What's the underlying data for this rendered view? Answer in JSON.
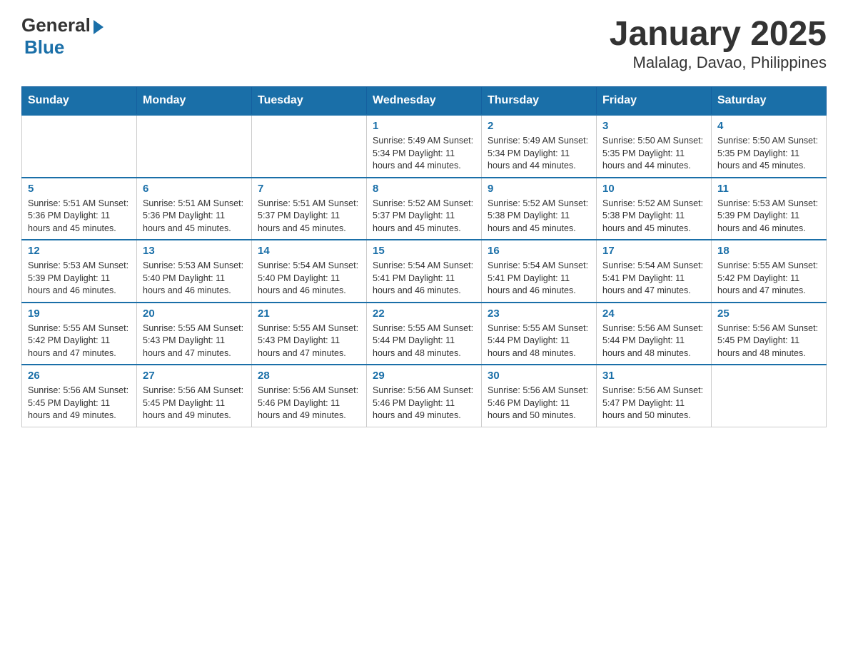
{
  "header": {
    "logo_general": "General",
    "logo_blue": "Blue",
    "title": "January 2025",
    "subtitle": "Malalag, Davao, Philippines"
  },
  "calendar": {
    "days_of_week": [
      "Sunday",
      "Monday",
      "Tuesday",
      "Wednesday",
      "Thursday",
      "Friday",
      "Saturday"
    ],
    "weeks": [
      [
        {
          "day": "",
          "info": ""
        },
        {
          "day": "",
          "info": ""
        },
        {
          "day": "",
          "info": ""
        },
        {
          "day": "1",
          "info": "Sunrise: 5:49 AM\nSunset: 5:34 PM\nDaylight: 11 hours and 44 minutes."
        },
        {
          "day": "2",
          "info": "Sunrise: 5:49 AM\nSunset: 5:34 PM\nDaylight: 11 hours and 44 minutes."
        },
        {
          "day": "3",
          "info": "Sunrise: 5:50 AM\nSunset: 5:35 PM\nDaylight: 11 hours and 44 minutes."
        },
        {
          "day": "4",
          "info": "Sunrise: 5:50 AM\nSunset: 5:35 PM\nDaylight: 11 hours and 45 minutes."
        }
      ],
      [
        {
          "day": "5",
          "info": "Sunrise: 5:51 AM\nSunset: 5:36 PM\nDaylight: 11 hours and 45 minutes."
        },
        {
          "day": "6",
          "info": "Sunrise: 5:51 AM\nSunset: 5:36 PM\nDaylight: 11 hours and 45 minutes."
        },
        {
          "day": "7",
          "info": "Sunrise: 5:51 AM\nSunset: 5:37 PM\nDaylight: 11 hours and 45 minutes."
        },
        {
          "day": "8",
          "info": "Sunrise: 5:52 AM\nSunset: 5:37 PM\nDaylight: 11 hours and 45 minutes."
        },
        {
          "day": "9",
          "info": "Sunrise: 5:52 AM\nSunset: 5:38 PM\nDaylight: 11 hours and 45 minutes."
        },
        {
          "day": "10",
          "info": "Sunrise: 5:52 AM\nSunset: 5:38 PM\nDaylight: 11 hours and 45 minutes."
        },
        {
          "day": "11",
          "info": "Sunrise: 5:53 AM\nSunset: 5:39 PM\nDaylight: 11 hours and 46 minutes."
        }
      ],
      [
        {
          "day": "12",
          "info": "Sunrise: 5:53 AM\nSunset: 5:39 PM\nDaylight: 11 hours and 46 minutes."
        },
        {
          "day": "13",
          "info": "Sunrise: 5:53 AM\nSunset: 5:40 PM\nDaylight: 11 hours and 46 minutes."
        },
        {
          "day": "14",
          "info": "Sunrise: 5:54 AM\nSunset: 5:40 PM\nDaylight: 11 hours and 46 minutes."
        },
        {
          "day": "15",
          "info": "Sunrise: 5:54 AM\nSunset: 5:41 PM\nDaylight: 11 hours and 46 minutes."
        },
        {
          "day": "16",
          "info": "Sunrise: 5:54 AM\nSunset: 5:41 PM\nDaylight: 11 hours and 46 minutes."
        },
        {
          "day": "17",
          "info": "Sunrise: 5:54 AM\nSunset: 5:41 PM\nDaylight: 11 hours and 47 minutes."
        },
        {
          "day": "18",
          "info": "Sunrise: 5:55 AM\nSunset: 5:42 PM\nDaylight: 11 hours and 47 minutes."
        }
      ],
      [
        {
          "day": "19",
          "info": "Sunrise: 5:55 AM\nSunset: 5:42 PM\nDaylight: 11 hours and 47 minutes."
        },
        {
          "day": "20",
          "info": "Sunrise: 5:55 AM\nSunset: 5:43 PM\nDaylight: 11 hours and 47 minutes."
        },
        {
          "day": "21",
          "info": "Sunrise: 5:55 AM\nSunset: 5:43 PM\nDaylight: 11 hours and 47 minutes."
        },
        {
          "day": "22",
          "info": "Sunrise: 5:55 AM\nSunset: 5:44 PM\nDaylight: 11 hours and 48 minutes."
        },
        {
          "day": "23",
          "info": "Sunrise: 5:55 AM\nSunset: 5:44 PM\nDaylight: 11 hours and 48 minutes."
        },
        {
          "day": "24",
          "info": "Sunrise: 5:56 AM\nSunset: 5:44 PM\nDaylight: 11 hours and 48 minutes."
        },
        {
          "day": "25",
          "info": "Sunrise: 5:56 AM\nSunset: 5:45 PM\nDaylight: 11 hours and 48 minutes."
        }
      ],
      [
        {
          "day": "26",
          "info": "Sunrise: 5:56 AM\nSunset: 5:45 PM\nDaylight: 11 hours and 49 minutes."
        },
        {
          "day": "27",
          "info": "Sunrise: 5:56 AM\nSunset: 5:45 PM\nDaylight: 11 hours and 49 minutes."
        },
        {
          "day": "28",
          "info": "Sunrise: 5:56 AM\nSunset: 5:46 PM\nDaylight: 11 hours and 49 minutes."
        },
        {
          "day": "29",
          "info": "Sunrise: 5:56 AM\nSunset: 5:46 PM\nDaylight: 11 hours and 49 minutes."
        },
        {
          "day": "30",
          "info": "Sunrise: 5:56 AM\nSunset: 5:46 PM\nDaylight: 11 hours and 50 minutes."
        },
        {
          "day": "31",
          "info": "Sunrise: 5:56 AM\nSunset: 5:47 PM\nDaylight: 11 hours and 50 minutes."
        },
        {
          "day": "",
          "info": ""
        }
      ]
    ]
  }
}
